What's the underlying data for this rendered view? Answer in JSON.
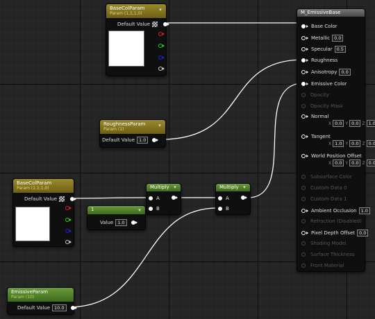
{
  "colors": {
    "param_header": "#8a7a24",
    "scalar_header": "#5a8a2e",
    "wire": "#ffffff",
    "pin_r": "#e02020",
    "pin_g": "#20d020",
    "pin_b": "#2020e0"
  },
  "icons": {
    "collapse": "chevron-down-icon",
    "checker": "checkerboard-icon"
  },
  "nodes": {
    "basecol_top": {
      "title": "BaseColParam",
      "subtitle": "Param (1,1,1,0)",
      "default_label": "Default Value",
      "swatch_color": "#ffffff"
    },
    "roughness": {
      "title": "RoughnessParam",
      "subtitle": "Param (1)",
      "default_label": "Default Value",
      "value": "1.0"
    },
    "basecol_bottom": {
      "title": "BaseColParam",
      "subtitle": "Param (1,1,1,0)",
      "default_label": "Default Value",
      "swatch_color": "#ffffff"
    },
    "scalar": {
      "title": "1",
      "value_label": "Value",
      "value": "1.0"
    },
    "multiply1": {
      "title": "Multiply",
      "pin_a": "A",
      "pin_b": "B"
    },
    "multiply2": {
      "title": "Multiply",
      "pin_a": "A",
      "pin_b": "B"
    },
    "emissive": {
      "title": "EmissiveParam",
      "subtitle": "Param (10)",
      "default_label": "Default Value",
      "value": "10.0"
    }
  },
  "material": {
    "title": "M_EmissiveBase",
    "inputs": [
      {
        "label": "Base Color",
        "active": true,
        "connected": true
      },
      {
        "label": "Metallic",
        "active": true,
        "value": "0.0"
      },
      {
        "label": "Specular",
        "active": true,
        "value": "0.5"
      },
      {
        "label": "Roughness",
        "active": true,
        "connected": true
      },
      {
        "label": "Anisotropy",
        "active": true,
        "value": "0.0"
      },
      {
        "label": "Emissive Color",
        "active": true,
        "connected": true
      },
      {
        "label": "Opacity",
        "active": false
      },
      {
        "label": "Opacity Mask",
        "active": false
      },
      {
        "label": "Normal",
        "active": true,
        "xyz": [
          {
            "l": "X",
            "v": "0.0"
          },
          {
            "l": "Y",
            "v": "0.0"
          },
          {
            "l": "Z",
            "v": "1.0"
          }
        ]
      },
      {
        "label": "Tangent",
        "active": true,
        "xyz": [
          {
            "l": "X",
            "v": "1.0"
          },
          {
            "l": "Y",
            "v": "0.0"
          },
          {
            "l": "Z",
            "v": "0.0"
          }
        ]
      },
      {
        "label": "World Position Offset",
        "active": true,
        "xyz": [
          {
            "l": "X",
            "v": "0.0"
          },
          {
            "l": "Y",
            "v": "0.0"
          },
          {
            "l": "Z",
            "v": "0.0"
          }
        ]
      },
      {
        "label": "Subsurface Color",
        "active": false
      },
      {
        "label": "Custom Data 0",
        "active": false
      },
      {
        "label": "Custom Data 1",
        "active": false
      },
      {
        "label": "Ambient Occlusion",
        "active": true,
        "value": "1.0"
      },
      {
        "label": "Refraction (Disabled)",
        "active": false
      },
      {
        "label": "Pixel Depth Offset",
        "active": true,
        "value": "0.0"
      },
      {
        "label": "Shading Model",
        "active": false
      },
      {
        "label": "Surface Thickness",
        "active": false
      },
      {
        "label": "Front Material",
        "active": false
      }
    ]
  }
}
